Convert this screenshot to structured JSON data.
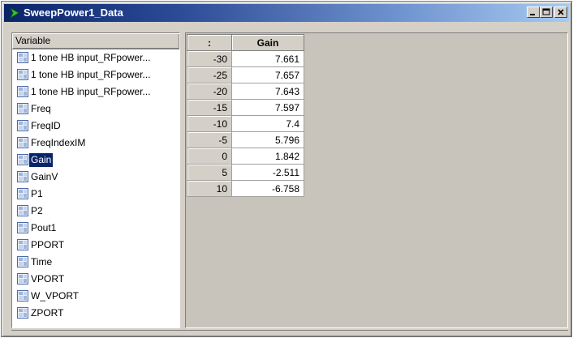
{
  "window": {
    "title": "SweepPower1_Data",
    "title_icon": "green-arrow-icon",
    "controls": [
      "minimize-icon",
      "maximize-icon",
      "close-icon"
    ],
    "colors": {
      "titlebar_start": "#0a246a",
      "titlebar_end": "#a6caf0",
      "selection": "#0a246a"
    }
  },
  "variables": {
    "header": "Variable",
    "item_icon": "dataset-icon",
    "selected": "Gain",
    "items": [
      "1 tone HB input_RFpower...",
      "1 tone HB input_RFpower...",
      "1 tone HB input_RFpower...",
      "Freq",
      "FreqID",
      "FreqIndexIM",
      "Gain",
      "GainV",
      "P1",
      "P2",
      "Pout1",
      "PPORT",
      "Time",
      "VPORT",
      "W_VPORT",
      "ZPORT"
    ]
  },
  "table": {
    "headers": [
      ":",
      "Gain"
    ],
    "rows": [
      [
        "-30",
        "7.661"
      ],
      [
        "-25",
        "7.657"
      ],
      [
        "-20",
        "7.643"
      ],
      [
        "-15",
        "7.597"
      ],
      [
        "-10",
        "7.4"
      ],
      [
        "-5",
        "5.796"
      ],
      [
        "0",
        "1.842"
      ],
      [
        "5",
        "-2.511"
      ],
      [
        "10",
        "-6.758"
      ]
    ]
  }
}
